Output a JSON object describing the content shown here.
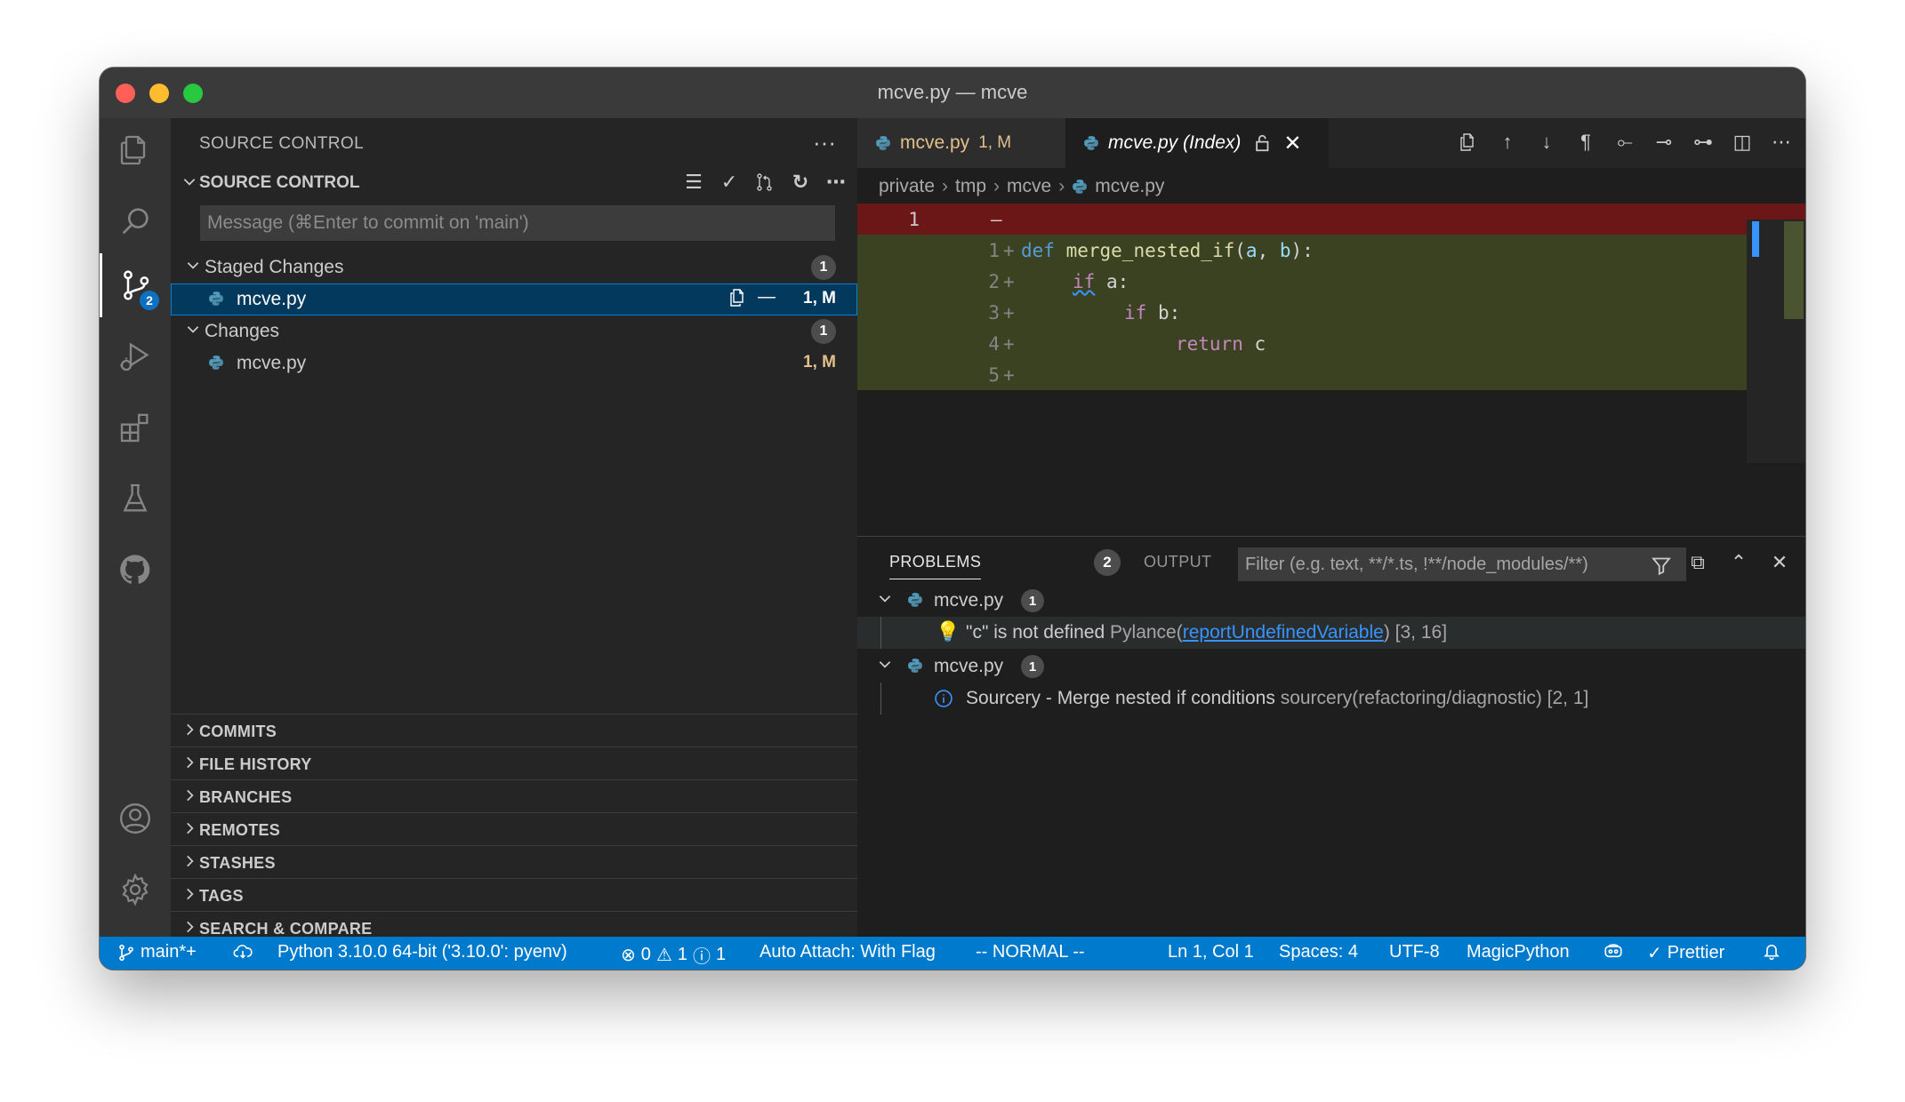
{
  "window": {
    "title": "mcve.py — mcve"
  },
  "activity_bar": {
    "items": [
      {
        "icon": "explorer-icon"
      },
      {
        "icon": "search-icon"
      },
      {
        "icon": "source-control-icon",
        "badge": "2"
      },
      {
        "icon": "run-debug-icon"
      },
      {
        "icon": "extensions-icon"
      },
      {
        "icon": "testing-icon"
      },
      {
        "icon": "github-icon"
      },
      {
        "icon": "account-icon"
      },
      {
        "icon": "settings-gear-icon"
      }
    ]
  },
  "sidebar": {
    "title": "SOURCE CONTROL",
    "more": "···",
    "section_title": "SOURCE CONTROL",
    "message_placeholder": "Message (⌘Enter to commit on 'main')",
    "staged_label": "Staged Changes",
    "staged_count": "1",
    "staged_file": "mcve.py",
    "staged_status": "1, M",
    "changes_label": "Changes",
    "changes_count": "1",
    "changes_file": "mcve.py",
    "changes_status": "1, M",
    "sections": [
      "COMMITS",
      "FILE HISTORY",
      "BRANCHES",
      "REMOTES",
      "STASHES",
      "TAGS",
      "SEARCH & COMPARE"
    ]
  },
  "editor": {
    "tab1_label": "mcve.py",
    "tab1_status": "1, M",
    "tab2_label": "mcve.py (Index)",
    "breadcrumb": [
      "private",
      "tmp",
      "mcve",
      "mcve.py"
    ],
    "removed_line_no": "1",
    "removed_mark": "—",
    "lines": [
      {
        "no": "1",
        "mark": "+"
      },
      {
        "no": "2",
        "mark": "+"
      },
      {
        "no": "3",
        "mark": "+"
      },
      {
        "no": "4",
        "mark": "+"
      },
      {
        "no": "5",
        "mark": "+"
      }
    ],
    "code": {
      "l1_kw": "def",
      "l1_fn": "merge_nested_if",
      "l1_p1": "a",
      "l1_p2": "b",
      "l2_kw": "if",
      "l2_rest": " a:",
      "l3_kw": "if",
      "l3_rest": " b:",
      "l4_kw": "return",
      "l4_rest": " c"
    }
  },
  "panel": {
    "tab_problems": "PROBLEMS",
    "problems_count": "2",
    "tab_output": "OUTPUT",
    "more": "···",
    "filter_placeholder": "Filter (e.g. text, **/*.ts, !**/node_modules/**)",
    "groups": [
      {
        "file": "mcve.py",
        "count": "1",
        "message": "\"c\" is not defined",
        "source": "Pylance(",
        "link": "reportUndefinedVariable",
        "source_end": ")",
        "pos": "[3, 16]"
      },
      {
        "file": "mcve.py",
        "count": "1",
        "message": "Sourcery - Merge nested if conditions",
        "source": "sourcery(refactoring/diagnostic)",
        "pos": "[2, 1]"
      }
    ]
  },
  "statusbar": {
    "branch": "main*+",
    "python": "Python 3.10.0 64-bit ('3.10.0': pyenv)",
    "errors": "0",
    "warnings": "1",
    "infos": "1",
    "auto_attach": "Auto Attach: With Flag",
    "vim_mode": "-- NORMAL --",
    "position": "Ln 1, Col 1",
    "spaces": "Spaces: 4",
    "encoding": "UTF-8",
    "language": "MagicPython",
    "prettier": "Prettier"
  },
  "colors": {
    "accent": "#007acc",
    "removed_bg": "#6b1717",
    "added_bg": "#3b4221",
    "modified": "#e2c08d"
  }
}
